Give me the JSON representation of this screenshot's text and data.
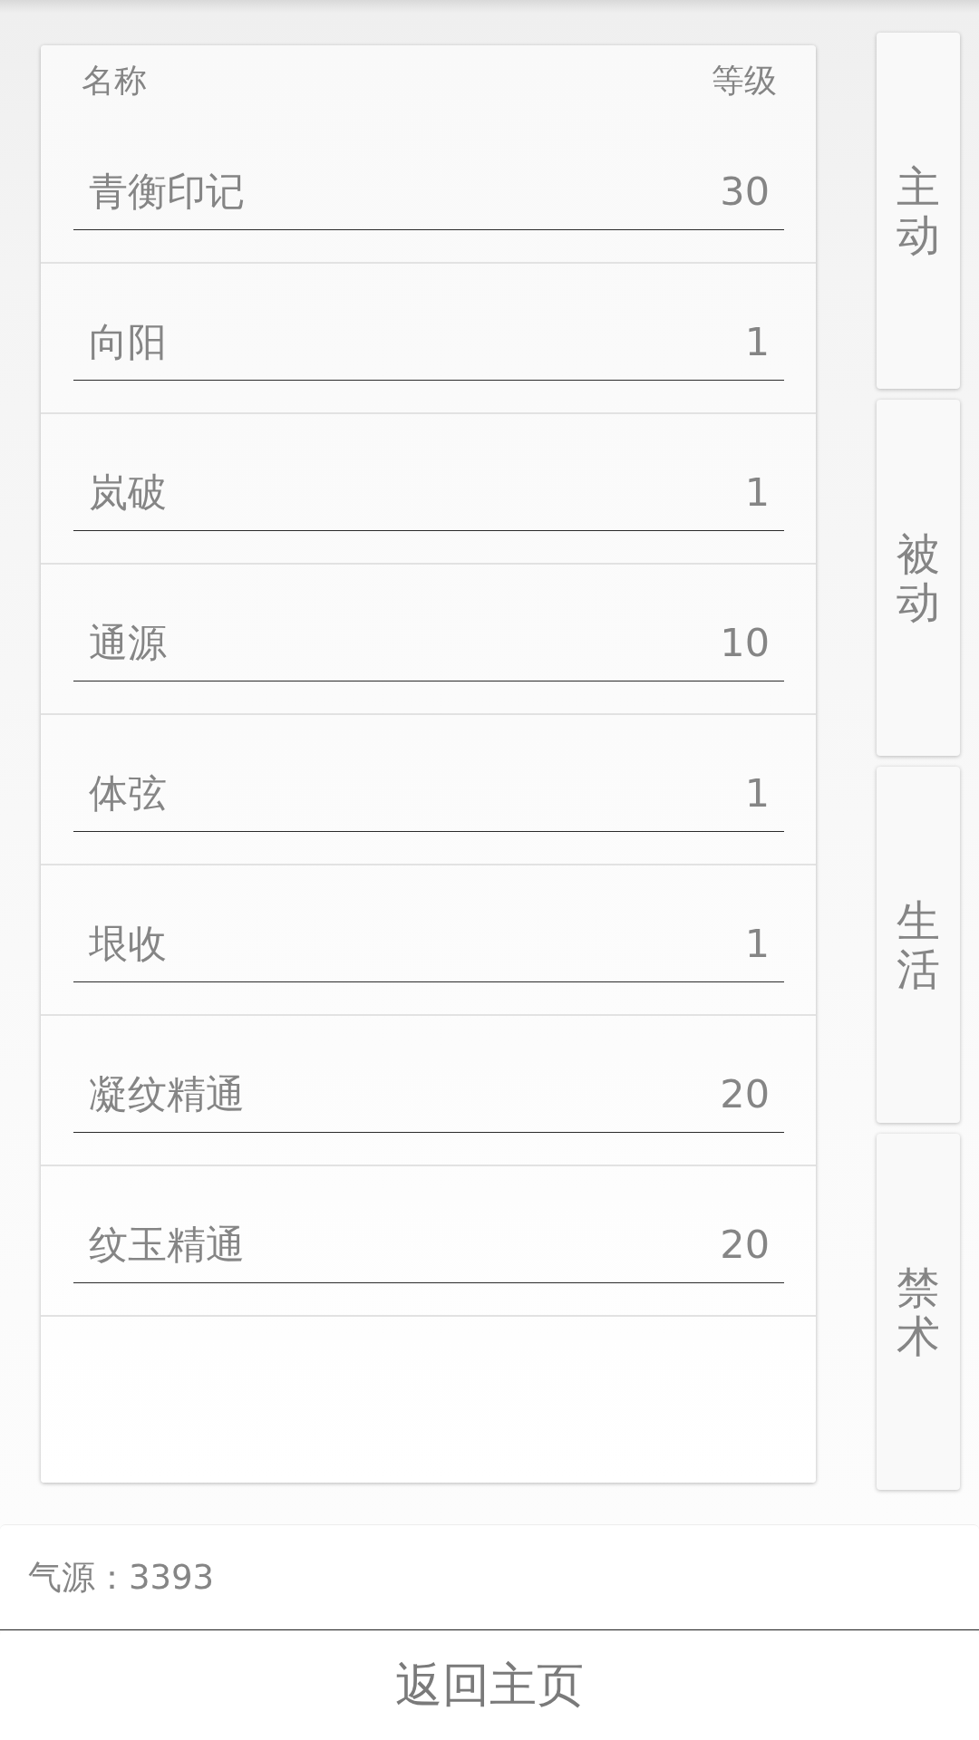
{
  "table": {
    "columns": [
      "名称",
      "等级"
    ],
    "rows": [
      {
        "name": "青衡印记",
        "value": "30"
      },
      {
        "name": "向阳",
        "value": "1"
      },
      {
        "name": "岚破",
        "value": "1"
      },
      {
        "name": "通源",
        "value": "10"
      },
      {
        "name": "体弦",
        "value": "1"
      },
      {
        "name": "垠收",
        "value": "1"
      },
      {
        "name": "凝纹精通",
        "value": "20"
      },
      {
        "name": "纹玉精通",
        "value": "20"
      }
    ]
  },
  "tabs": [
    {
      "label": "主动"
    },
    {
      "label": "被动"
    },
    {
      "label": "生活"
    },
    {
      "label": "禁术"
    }
  ],
  "status": {
    "text": "气源：3393"
  },
  "home_button": {
    "label": "返回主页"
  }
}
